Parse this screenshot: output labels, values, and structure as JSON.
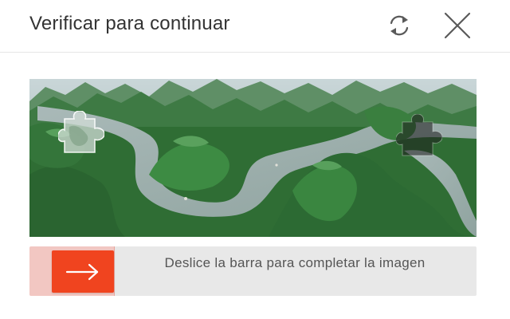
{
  "dialog": {
    "title": "Verificar para continuar",
    "refresh_icon": "refresh-icon",
    "close_icon": "close-icon"
  },
  "captcha": {
    "image_subject": "river-karst-landscape",
    "puzzle_piece_icon": "puzzle-piece-icon",
    "slot_icon": "puzzle-slot-icon"
  },
  "slider": {
    "hint": "Deslice la barra para completar la imagen",
    "handle_icon": "arrow-right-icon",
    "progress": 0,
    "colors": {
      "handle": "#f0441f",
      "fill": "#f2c7c2",
      "track": "#e8e8e8"
    }
  }
}
